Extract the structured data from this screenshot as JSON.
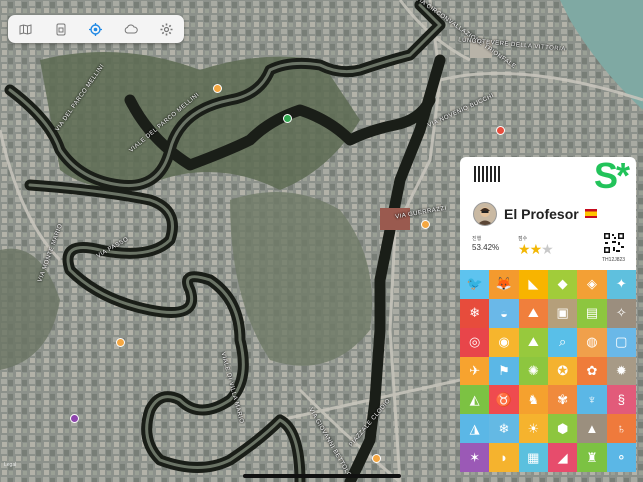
{
  "toolbar": {
    "icons": [
      "map-icon",
      "sim-card-icon",
      "location-target-icon",
      "cloud-icon",
      "gear-icon"
    ]
  },
  "map": {
    "street_labels": [
      "VIA DEL PARCO MELLINI",
      "VIALE DEL PARCO MELLINI",
      "VIA DEI CAVALIERI",
      "VIA TRIONFALE",
      "VIA MONTE MARIO",
      "VIA NOVENIO BUCCHI",
      "VIA GUERRAZZI",
      "VIA CIRCONVALLAZIONE TRIONFALE",
      "LUNGOTEVERE DELLA VITTORIA",
      "VIALE ANGELICO",
      "VIA PASSO",
      "VIALE DI VILLA MARIO",
      "VIA DOMENICO SILVERI",
      "PIAZZALE CLODIO",
      "VIA GIOVANNI BETTOLO"
    ],
    "accent_poi": "#f4a742",
    "attribution": "Legal"
  },
  "card": {
    "name": "El Profesor",
    "progress_label": "진행",
    "progress_value": "53.42%",
    "score_label": "점수",
    "stars_filled": 2,
    "stars_total": 3,
    "serial": "TH12J823",
    "logo": "S*"
  },
  "grid": {
    "tiles": [
      {
        "icon": "bird-icon",
        "color": "#5ec3ef"
      },
      {
        "icon": "fox-icon",
        "color": "#f49a2e"
      },
      {
        "icon": "south-america-icon",
        "color": "#f8b400"
      },
      {
        "icon": "africa-icon",
        "color": "#a1cc3a"
      },
      {
        "icon": "asia-icon",
        "color": "#f3a035"
      },
      {
        "icon": "europe-icon",
        "color": "#5fc0de"
      },
      {
        "icon": "antarctica-icon",
        "color": "#e74c3c"
      },
      {
        "icon": "turtle-icon",
        "color": "#6ab8e8"
      },
      {
        "icon": "hiker-icon",
        "color": "#f07f3c"
      },
      {
        "icon": "luggage-icon",
        "color": "#b59f7a"
      },
      {
        "icon": "document-icon",
        "color": "#8dc63f"
      },
      {
        "icon": "compass-icon",
        "color": "#9b8e7e"
      },
      {
        "icon": "binoculars-icon",
        "color": "#e8454a"
      },
      {
        "icon": "globe-icon",
        "color": "#f6b52d"
      },
      {
        "icon": "climber-icon",
        "color": "#97c93d"
      },
      {
        "icon": "magnifier-icon",
        "color": "#59bfe8"
      },
      {
        "icon": "earth-icon",
        "color": "#f0a04b"
      },
      {
        "icon": "passport-icon",
        "color": "#6ab8e8"
      },
      {
        "icon": "airplane-icon",
        "color": "#f7a32f"
      },
      {
        "icon": "flag-icon",
        "color": "#5bb7e6"
      },
      {
        "icon": "stars-circle-icon",
        "color": "#8dc63f"
      },
      {
        "icon": "eu-icon",
        "color": "#f4b22f"
      },
      {
        "icon": "ribbon-icon",
        "color": "#ef7c3a"
      },
      {
        "icon": "seal-icon",
        "color": "#a79a86"
      },
      {
        "icon": "bear-icon",
        "color": "#7cc243"
      },
      {
        "icon": "bull-icon",
        "color": "#ef4b4f"
      },
      {
        "icon": "kangaroo-icon",
        "color": "#f5a12e"
      },
      {
        "icon": "rose-icon",
        "color": "#f08a3c"
      },
      {
        "icon": "mermaid-icon",
        "color": "#5bb7e6"
      },
      {
        "icon": "seahorse-icon",
        "color": "#e25b7a"
      },
      {
        "icon": "polar-bear-icon",
        "color": "#5bb7e6"
      },
      {
        "icon": "snowflake-icon",
        "color": "#64b9e4"
      },
      {
        "icon": "sun-icon",
        "color": "#f5b32e"
      },
      {
        "icon": "turtle-shell-icon",
        "color": "#8dc63f"
      },
      {
        "icon": "volcano-icon",
        "color": "#9b8f7e"
      },
      {
        "icon": "saturn-icon",
        "color": "#ef7a3c"
      },
      {
        "icon": "octopus-icon",
        "color": "#9b59b6"
      },
      {
        "icon": "whale-icon",
        "color": "#f5b32e"
      },
      {
        "icon": "calendar-icon",
        "color": "#5bc0de"
      },
      {
        "icon": "shoe-icon",
        "color": "#e74c6c"
      },
      {
        "icon": "castle-icon",
        "color": "#7cc243"
      },
      {
        "icon": "olympic-rings-icon",
        "color": "#5bb7e6"
      }
    ]
  }
}
